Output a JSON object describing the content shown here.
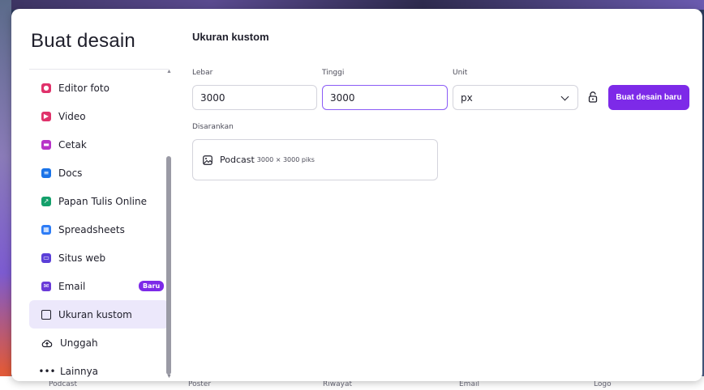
{
  "modal": {
    "title": "Buat desain"
  },
  "sidebar": {
    "items": [
      {
        "label": "Editor foto",
        "icon": "photo-editor-icon",
        "color": "#e0326b"
      },
      {
        "label": "Video",
        "icon": "video-icon",
        "color": "#e0326b"
      },
      {
        "label": "Cetak",
        "icon": "print-icon",
        "color": "#b833c8"
      },
      {
        "label": "Docs",
        "icon": "docs-icon",
        "color": "#1a73e8"
      },
      {
        "label": "Papan Tulis Online",
        "icon": "whiteboard-icon",
        "color": "#14a06b"
      },
      {
        "label": "Spreadsheets",
        "icon": "spreadsheets-icon",
        "color": "#2d7cf6"
      },
      {
        "label": "Situs web",
        "icon": "website-icon",
        "color": "#5b3fd8"
      },
      {
        "label": "Email",
        "icon": "email-icon",
        "color": "#6a3bd8",
        "badge": "Baru"
      },
      {
        "label": "Ukuran kustom",
        "icon": "custom-size-icon",
        "active": true
      },
      {
        "label": "Unggah",
        "icon": "upload-icon"
      },
      {
        "label": "Lainnya",
        "icon": "more-icon"
      }
    ]
  },
  "content": {
    "title": "Ukuran kustom",
    "width_label": "Lebar",
    "width_value": "3000",
    "height_label": "Tinggi",
    "height_value": "3000",
    "unit_label": "Unit",
    "unit_value": "px",
    "create_label": "Buat desain baru",
    "suggest_label": "Disarankan",
    "suggestion": {
      "name": "Podcast",
      "dims": "3000 × 3000 piks"
    }
  },
  "background": {
    "bottom_items": [
      "Podcast",
      "Poster",
      "Riwayat",
      "Email",
      "Logo"
    ]
  },
  "colors": {
    "accent": "#7d2ae8",
    "focus": "#8b5cf6",
    "active_bg": "#ece8fb"
  }
}
